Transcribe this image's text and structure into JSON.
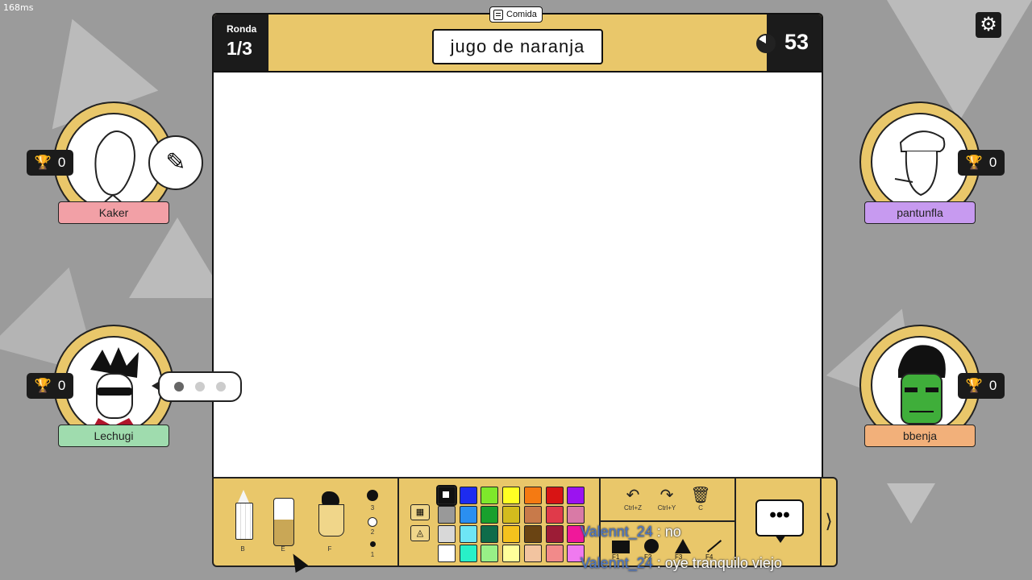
{
  "debug": {
    "latency": "168ms"
  },
  "header": {
    "round_label": "Ronda",
    "round_value": "1/3",
    "category": "Comida",
    "word": "jugo de naranja",
    "timer": "53"
  },
  "players": [
    {
      "name": "Kaker",
      "score": "0",
      "tag_color": "#f2a0a6",
      "status": "drawing"
    },
    {
      "name": "Lechugi",
      "score": "0",
      "tag_color": "#9fdcae",
      "status": "typing"
    },
    {
      "name": "pantunfla",
      "score": "0",
      "tag_color": "#c79af0"
    },
    {
      "name": "bbenja",
      "score": "0",
      "tag_color": "#f2b07a"
    }
  ],
  "tools": {
    "pencil_key": "B",
    "eraser_key": "E",
    "fill_key": "F",
    "sizes": [
      "3",
      "2",
      "1"
    ]
  },
  "palette": [
    "#ffffff",
    "#1d2cf0",
    "#7ee82b",
    "#ffff23",
    "#f57a12",
    "#d81414",
    "#9b13f0",
    "#999999",
    "#2b8ff0",
    "#18a02d",
    "#d3bb1d",
    "#c87a4a",
    "#e03a4a",
    "#d97aa6",
    "#d8d8d8",
    "#6ee5f5",
    "#0f6c4a",
    "#f5c21d",
    "#6a4413",
    "#9c1c36",
    "#f0189a",
    "#ffffff",
    "#28f0c8",
    "#98f087",
    "#ffff9a",
    "#f2c4a0",
    "#f28a8a",
    "#f07af0"
  ],
  "actions": {
    "undo_key": "Ctrl+Z",
    "redo_key": "Ctrl+Y",
    "clear_key": "C",
    "shape_keys": [
      "F1",
      "F2",
      "F3",
      "F4"
    ]
  },
  "chat": {
    "messages": [
      {
        "user": "Valennt_24",
        "text": ": no"
      },
      {
        "user": "Valennt_24",
        "text": ": oye tranquilo viejo"
      }
    ],
    "more_arrow": "⟩"
  }
}
